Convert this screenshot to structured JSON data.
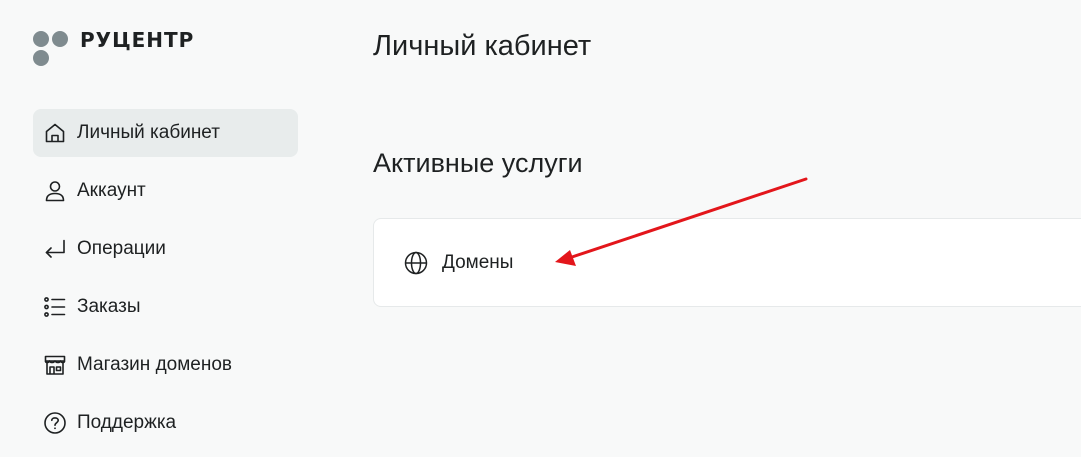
{
  "brand": {
    "name": "РУЦЕНТР"
  },
  "sidebar": {
    "items": [
      {
        "label": "Личный кабинет",
        "icon": "home-icon",
        "active": true
      },
      {
        "label": "Аккаунт",
        "icon": "user-icon",
        "active": false
      },
      {
        "label": "Операции",
        "icon": "return-icon",
        "active": false
      },
      {
        "label": "Заказы",
        "icon": "list-icon",
        "active": false
      },
      {
        "label": "Магазин доменов",
        "icon": "shop-icon",
        "active": false
      },
      {
        "label": "Поддержка",
        "icon": "help-icon",
        "active": false
      }
    ]
  },
  "main": {
    "title": "Личный кабинет",
    "section_title": "Активные услуги",
    "services": [
      {
        "label": "Домены",
        "icon": "globe-icon"
      }
    ]
  },
  "colors": {
    "background": "#f8f9f9",
    "active_item": "#e8ecec",
    "logo_dots": "#7f8b8f",
    "annotation_arrow": "#e3161b"
  }
}
